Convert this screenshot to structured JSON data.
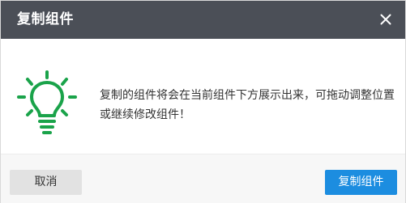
{
  "dialog": {
    "title": "复制组件",
    "close_icon": "close-icon",
    "message": "复制的组件将会在当前组件下方展示出来，可拖动调整位置或继续修改组件！",
    "illustration_icon": "lightbulb-icon",
    "cancel_label": "取消",
    "confirm_label": "复制组件"
  },
  "colors": {
    "title_bar": "#4b4f57",
    "bulb": "#1aa34a",
    "confirm_button": "#1c8de0",
    "cancel_button": "#e2e2e2"
  }
}
